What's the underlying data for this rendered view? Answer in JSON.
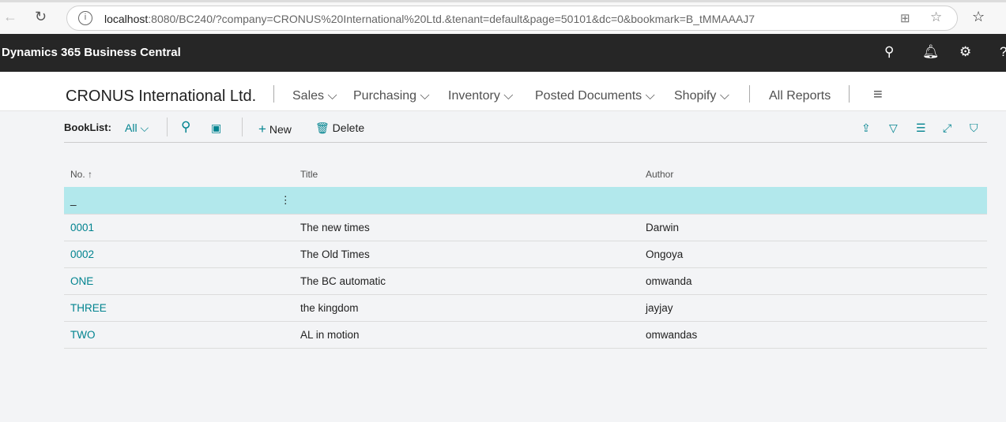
{
  "browser": {
    "url_host": "localhost",
    "url_rest": ":8080/BC240/?company=CRONUS%20International%20Ltd.&tenant=default&page=50101&dc=0&bookmark=B_tMMAAAJ7"
  },
  "app": {
    "title": "Dynamics 365 Business Central"
  },
  "nav": {
    "company": "CRONUS International Ltd.",
    "items": [
      "Sales",
      "Purchasing",
      "Inventory",
      "Posted Documents",
      "Shopify"
    ],
    "all_reports": "All Reports"
  },
  "actions": {
    "list_label": "BookList:",
    "filter": "All",
    "new": "New",
    "delete": "Delete"
  },
  "table": {
    "headers": [
      "No. ↑",
      "Title",
      "Author"
    ],
    "new_row": "_",
    "rows": [
      {
        "no": "0001",
        "title": "The new times",
        "author": "Darwin"
      },
      {
        "no": "0002",
        "title": "The Old Times",
        "author": "Ongoya"
      },
      {
        "no": "ONE",
        "title": "The BC automatic",
        "author": "omwanda"
      },
      {
        "no": "THREE",
        "title": "the kingdom",
        "author": "jayjay"
      },
      {
        "no": "TWO",
        "title": "AL in motion",
        "author": "omwandas"
      }
    ]
  },
  "colors": {
    "accent": "#00838f",
    "selected": "#b2e8ec"
  }
}
